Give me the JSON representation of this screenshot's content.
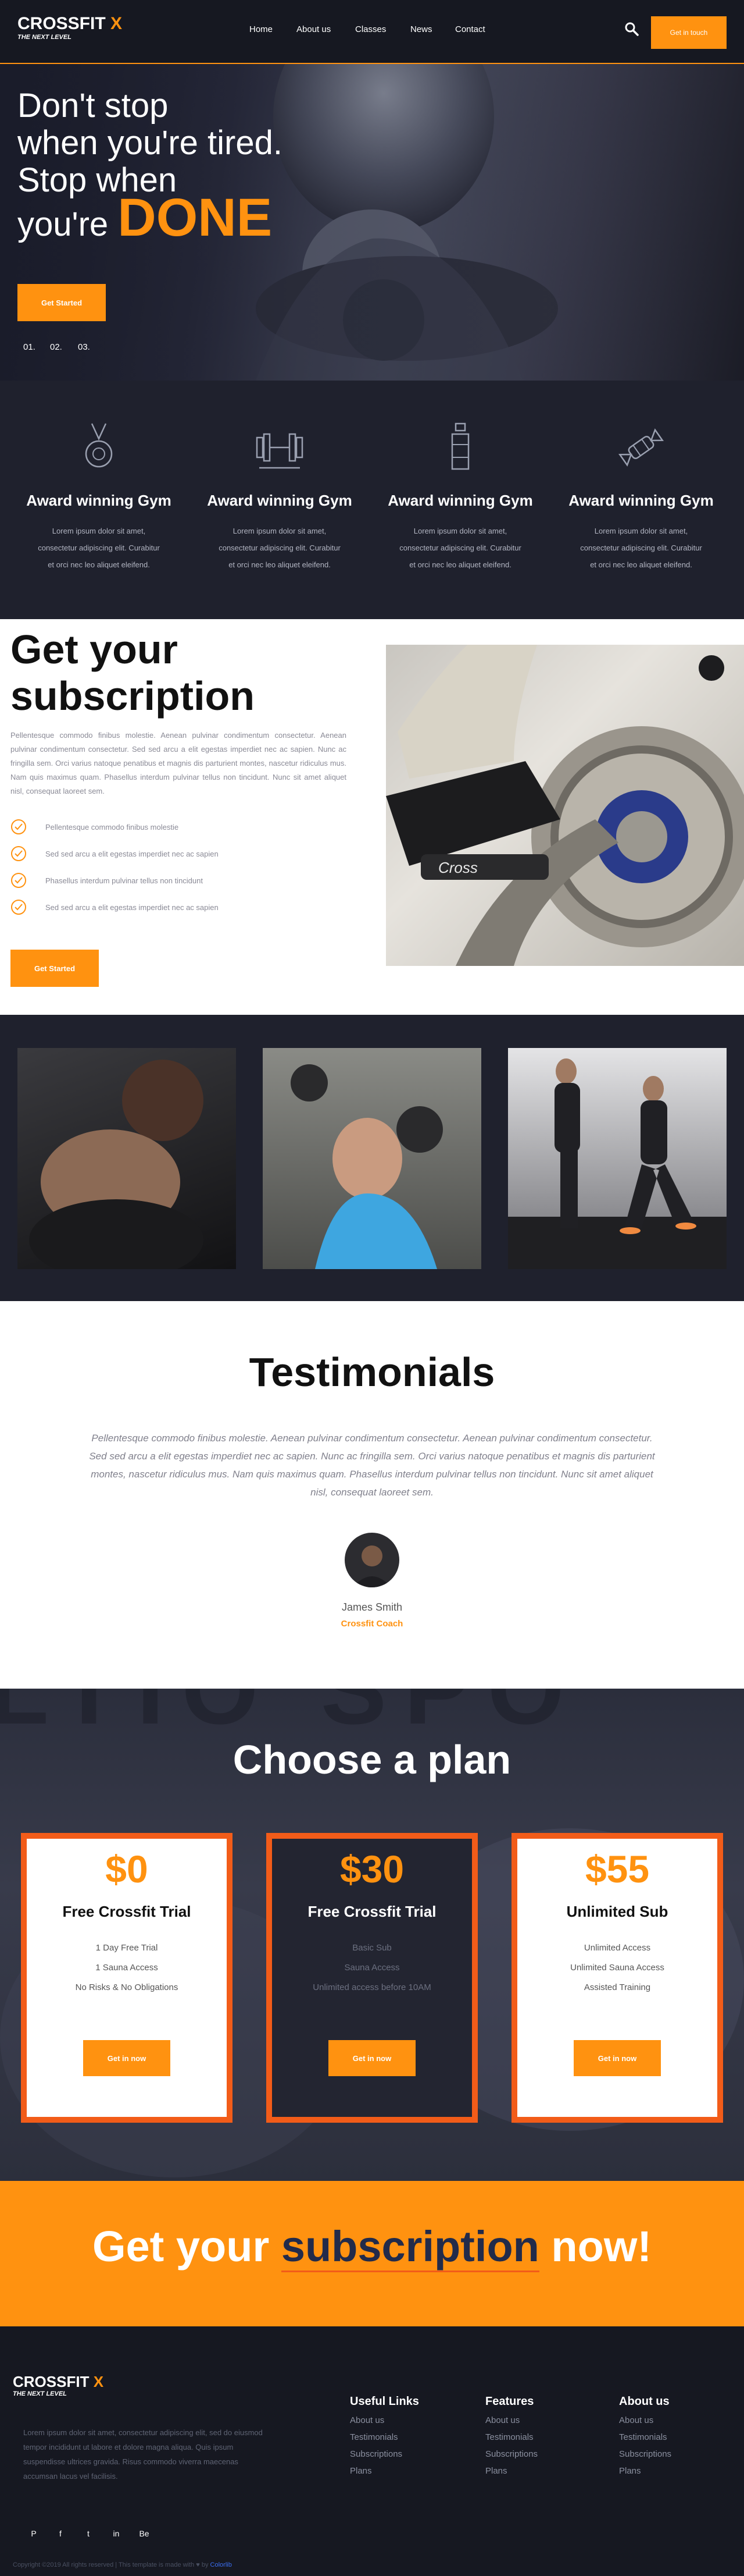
{
  "colors": {
    "accent": "#ff9210",
    "dark": "#1f212d",
    "plan_border": "#f25c19"
  },
  "brand": {
    "name": "CROSSFIT",
    "x": "X",
    "tagline": "THE NEXT LEVEL"
  },
  "nav": {
    "items": [
      "Home",
      "About us",
      "Classes",
      "News",
      "Contact"
    ],
    "search_icon": "search-icon",
    "cta": "Get in touch"
  },
  "hero": {
    "line1": "Don't stop",
    "line2": "when you're tired.",
    "line3": "Stop when",
    "line4_pre": "you're",
    "line4_word": "DONE",
    "button": "Get Started",
    "slides": [
      "01.",
      "02.",
      "03."
    ]
  },
  "awards": [
    {
      "icon": "medal-icon",
      "title": "Award winning Gym",
      "text": "Lorem ipsum dolor sit amet, consectetur adipiscing elit. Curabitur et orci nec leo aliquet eleifend."
    },
    {
      "icon": "barbell-icon",
      "title": "Award winning Gym",
      "text": "Lorem ipsum dolor sit amet, consectetur adipiscing elit. Curabitur et orci nec leo aliquet eleifend."
    },
    {
      "icon": "bottle-icon",
      "title": "Award winning Gym",
      "text": "Lorem ipsum dolor sit amet, consectetur adipiscing elit. Curabitur et orci nec leo aliquet eleifend."
    },
    {
      "icon": "candy-icon",
      "title": "Award winning Gym",
      "text": "Lorem ipsum dolor sit amet, consectetur adipiscing elit. Curabitur et orci nec leo aliquet eleifend."
    }
  ],
  "subscription": {
    "title_l1": "Get your",
    "title_l2": "subscription",
    "text": "Pellentesque commodo finibus molestie. Aenean pulvinar condimentum consectetur. Aenean pulvinar condimentum consectetur. Sed sed arcu a elit egestas imperdiet nec ac sapien. Nunc ac fringilla sem. Orci varius natoque penatibus et magnis dis parturient montes, nascetur ridiculus mus. Nam quis maximus quam. Phasellus interdum pulvinar tellus non tincidunt. Nunc sit amet aliquet nisl, consequat laoreet sem.",
    "checks": [
      "Pellentesque commodo finibus molestie",
      "Sed sed arcu a elit egestas imperdiet nec ac sapien",
      "Phasellus interdum pulvinar tellus non tincidunt",
      "Sed sed arcu a elit egestas imperdiet nec ac sapien"
    ],
    "button": "Get Started",
    "bike_brand": "Cross"
  },
  "testimonials": {
    "title": "Testimonials",
    "quote": "Pellentesque commodo finibus molestie. Aenean pulvinar condimentum consectetur. Aenean pulvinar condimentum consectetur. Sed sed arcu a elit egestas imperdiet nec ac sapien. Nunc ac fringilla sem. Orci varius natoque penatibus et magnis dis parturient montes, nascetur ridiculus mus. Nam quis maximus quam. Phasellus interdum pulvinar tellus non tincidunt. Nunc sit amet aliquet nisl, consequat laoreet sem.",
    "name": "James Smith",
    "role": "Crossfit Coach"
  },
  "pricing": {
    "title": "Choose a plan",
    "plans": [
      {
        "price": "$0",
        "name": "Free Crossfit Trial",
        "features": [
          "1 Day Free Trial",
          "1 Sauna Access",
          "No Risks & No Obligations"
        ],
        "button": "Get in now"
      },
      {
        "price": "$30",
        "name": "Free Crossfit Trial",
        "features": [
          "Basic Sub",
          "Sauna Access",
          "Unlimited access before 10AM"
        ],
        "button": "Get in now"
      },
      {
        "price": "$55",
        "name": "Unlimited Sub",
        "features": [
          "Unlimited Access",
          "Unlimited Sauna Access",
          "Assisted Training"
        ],
        "button": "Get in now"
      }
    ]
  },
  "cta": {
    "pre": "Get your",
    "word": "subscription",
    "post": "now!"
  },
  "footer": {
    "about": "Lorem ipsum dolor sit amet, consectetur adipiscing elit, sed do eiusmod tempor incididunt ut labore et dolore magna aliqua. Quis ipsum suspendisse ultrices gravida. Risus commodo viverra maecenas accumsan lacus vel facilisis.",
    "cols": [
      {
        "title": "Useful Links",
        "links": [
          "About us",
          "Testimonials",
          "Subscriptions",
          "Plans"
        ]
      },
      {
        "title": "Features",
        "links": [
          "About us",
          "Testimonials",
          "Subscriptions",
          "Plans"
        ]
      },
      {
        "title": "About us",
        "links": [
          "About us",
          "Testimonials",
          "Subscriptions",
          "Plans"
        ]
      }
    ],
    "social": [
      "P",
      "f",
      "t",
      "in",
      "Be"
    ],
    "copyright": "Copyright ©2019 All rights reserved | This template is made with",
    "by": "by",
    "author": "Colorlib"
  }
}
